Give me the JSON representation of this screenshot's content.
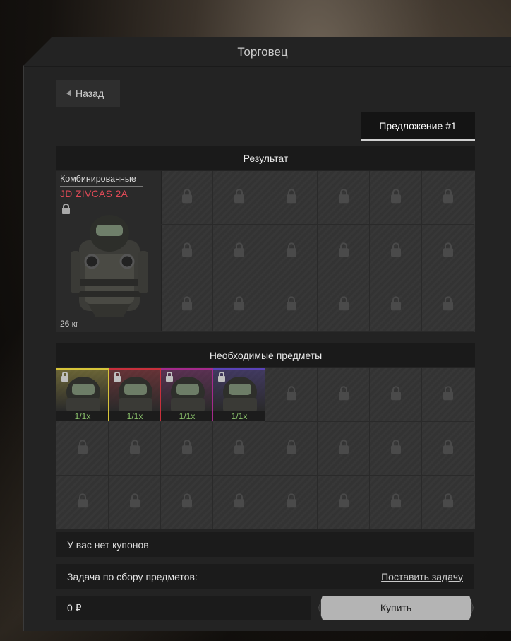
{
  "window": {
    "title": "Торговец"
  },
  "nav": {
    "back_label": "Назад"
  },
  "offer_tab": {
    "label": "Предложение #1"
  },
  "result": {
    "header": "Результат",
    "item": {
      "category": "Комбинированные",
      "name": "JD ZIVCAS 2A",
      "weight": "26 кг",
      "name_color": "#e04a57",
      "icon": "lock-icon"
    },
    "locked_slots": 18
  },
  "required": {
    "header": "Необходимые предметы",
    "items": [
      {
        "qty": "1/1x",
        "rarity_color": "#d6c43a"
      },
      {
        "qty": "1/1x",
        "rarity_color": "#c8303c"
      },
      {
        "qty": "1/1x",
        "rarity_color": "#a52a8c"
      },
      {
        "qty": "1/1x",
        "rarity_color": "#5a43b8"
      }
    ],
    "locked_slots": 20
  },
  "coupons": {
    "text": "У вас нет купонов"
  },
  "task": {
    "label": "Задача по сбору предметов:",
    "link": "Поставить задачу"
  },
  "price": {
    "value": "0 ₽"
  },
  "buy": {
    "label": "Купить"
  }
}
